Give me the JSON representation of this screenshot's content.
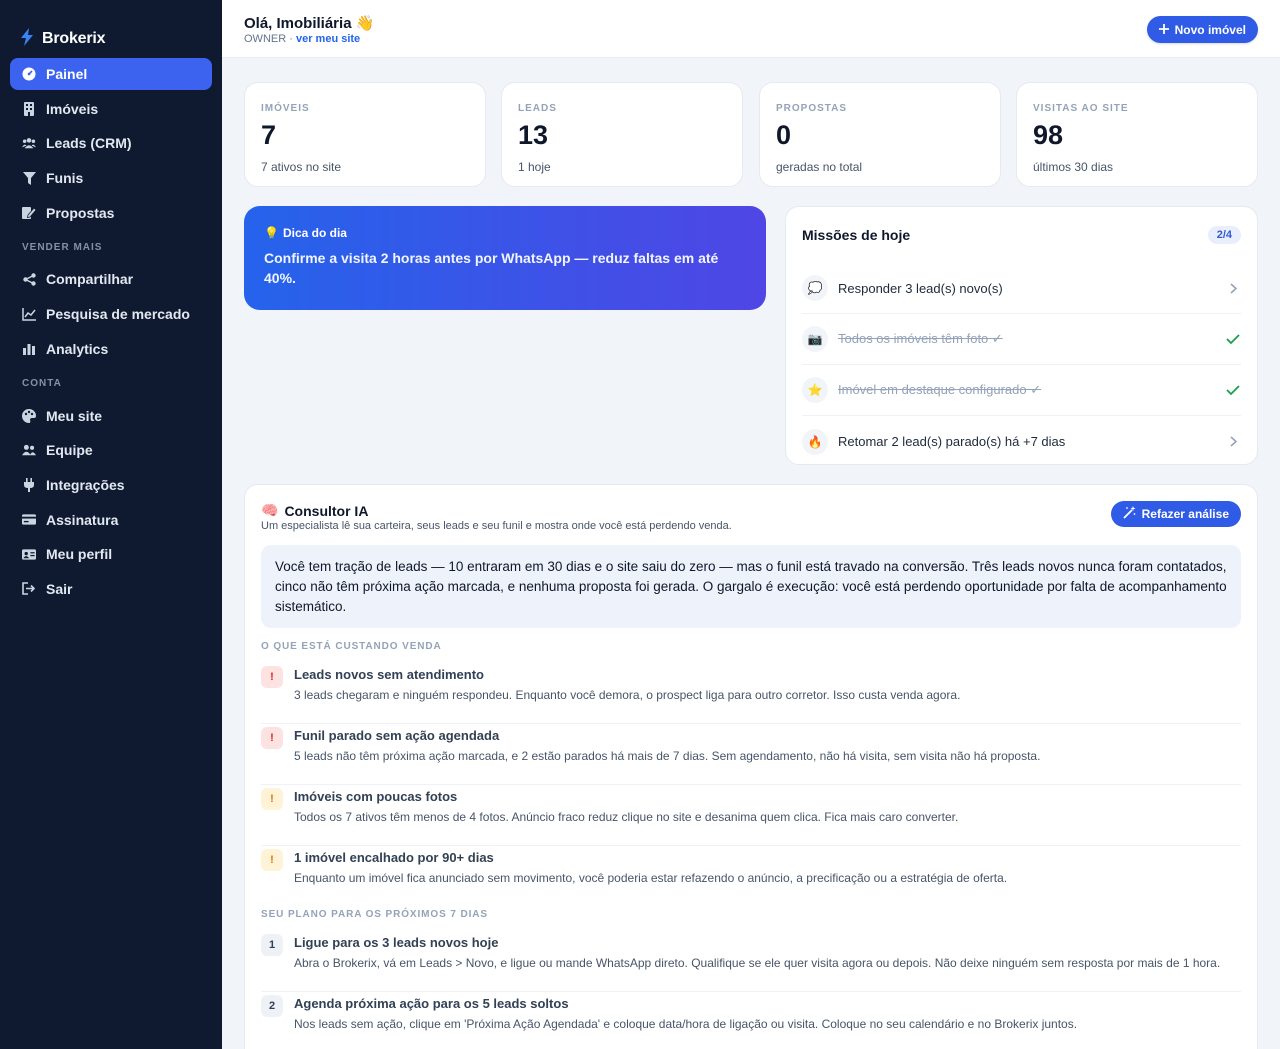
{
  "app": {
    "name": "Brokerix",
    "accent": "#3b63f0"
  },
  "sidebar": {
    "items": [
      {
        "label": "Painel",
        "icon": "dashboard-icon",
        "active": true
      },
      {
        "label": "Imóveis",
        "icon": "building-icon"
      },
      {
        "label": "Leads (CRM)",
        "icon": "users-icon"
      },
      {
        "label": "Funis",
        "icon": "funnel-icon"
      },
      {
        "label": "Propostas",
        "icon": "edit-icon"
      }
    ],
    "section_sell": "VENDER MAIS",
    "sell_items": [
      {
        "label": "Compartilhar",
        "icon": "share-icon"
      },
      {
        "label": "Pesquisa de mercado",
        "icon": "chart-line-icon"
      },
      {
        "label": "Analytics",
        "icon": "bar-chart-icon"
      }
    ],
    "section_account": "CONTA",
    "account_items": [
      {
        "label": "Meu site",
        "icon": "palette-icon"
      },
      {
        "label": "Equipe",
        "icon": "team-icon"
      },
      {
        "label": "Integrações",
        "icon": "plug-icon"
      },
      {
        "label": "Assinatura",
        "icon": "credit-card-icon"
      },
      {
        "label": "Meu perfil",
        "icon": "id-card-icon"
      },
      {
        "label": "Sair",
        "icon": "logout-icon"
      }
    ]
  },
  "header": {
    "greeting": "Olá, Imobiliária 👋",
    "role": "OWNER",
    "separator": "·",
    "site_link": "ver meu site",
    "new_button": "Novo imóvel"
  },
  "stats": [
    {
      "label": "IMÓVEIS",
      "value": "7",
      "sub": "7 ativos no site"
    },
    {
      "label": "LEADS",
      "value": "13",
      "sub": "1 hoje"
    },
    {
      "label": "PROPOSTAS",
      "value": "0",
      "sub": "geradas no total"
    },
    {
      "label": "VISITAS AO SITE",
      "value": "98",
      "sub": "últimos 30 dias"
    }
  ],
  "tip": {
    "label": "Dica do dia",
    "text": "Confirme a visita 2 horas antes por WhatsApp — reduz faltas em até 40%."
  },
  "missions": {
    "title": "Missões de hoje",
    "progress": "2/4",
    "items": [
      {
        "icon": "💭",
        "text": "Responder 3 lead(s) novo(s)",
        "done": false
      },
      {
        "icon": "📷",
        "text": "Todos os imóveis têm foto ✓",
        "done": true
      },
      {
        "icon": "⭐",
        "text": "Imóvel em destaque configurado ✓",
        "done": true
      },
      {
        "icon": "🔥",
        "text": "Retomar 2 lead(s) parado(s) há +7 dias",
        "done": false
      }
    ]
  },
  "consultor": {
    "title": "Consultor IA",
    "subtitle": "Um especialista lê sua carteira, seus leads e seu funil e mostra onde você está perdendo venda.",
    "redo_button": "Refazer análise",
    "summary": "Você tem tração de leads — 10 entraram em 30 dias e o site saiu do zero — mas o funil está travado na conversão. Três leads novos nunca foram contatados, cinco não têm próxima ação marcada, e nenhuma proposta foi gerada. O gargalo é execução: você está perdendo oportunidade por falta de acompanhamento sistemático.",
    "costs_heading": "O QUE ESTÁ CUSTANDO VENDA",
    "costs": [
      {
        "badge": "!",
        "level": "red",
        "title": "Leads novos sem atendimento",
        "desc": "3 leads chegaram e ninguém respondeu. Enquanto você demora, o prospect liga para outro corretor. Isso custa venda agora."
      },
      {
        "badge": "!",
        "level": "red",
        "title": "Funil parado sem ação agendada",
        "desc": "5 leads não têm próxima ação marcada, e 2 estão parados há mais de 7 dias. Sem agendamento, não há visita, sem visita não há proposta."
      },
      {
        "badge": "!",
        "level": "yellow",
        "title": "Imóveis com poucas fotos",
        "desc": "Todos os 7 ativos têm menos de 4 fotos. Anúncio fraco reduz clique no site e desanima quem clica. Fica mais caro converter."
      },
      {
        "badge": "!",
        "level": "yellow",
        "title": "1 imóvel encalhado por 90+ dias",
        "desc": "Enquanto um imóvel fica anunciado sem movimento, você poderia estar refazendo o anúncio, a precificação ou a estratégia de oferta."
      }
    ],
    "plan_heading": "SEU PLANO PARA OS PRÓXIMOS 7 DIAS",
    "plan": [
      {
        "badge": "1",
        "title": "Ligue para os 3 leads novos hoje",
        "desc": "Abra o Brokerix, vá em Leads > Novo, e ligue ou mande WhatsApp direto. Qualifique se ele quer visita agora ou depois. Não deixe ninguém sem resposta por mais de 1 hora."
      },
      {
        "badge": "2",
        "title": "Agenda próxima ação para os 5 leads soltos",
        "desc": "Nos leads sem ação, clique em 'Próxima Ação Agendada' e coloque data/hora de ligação ou visita. Coloque no seu calendário e no Brokerix juntos."
      }
    ]
  }
}
